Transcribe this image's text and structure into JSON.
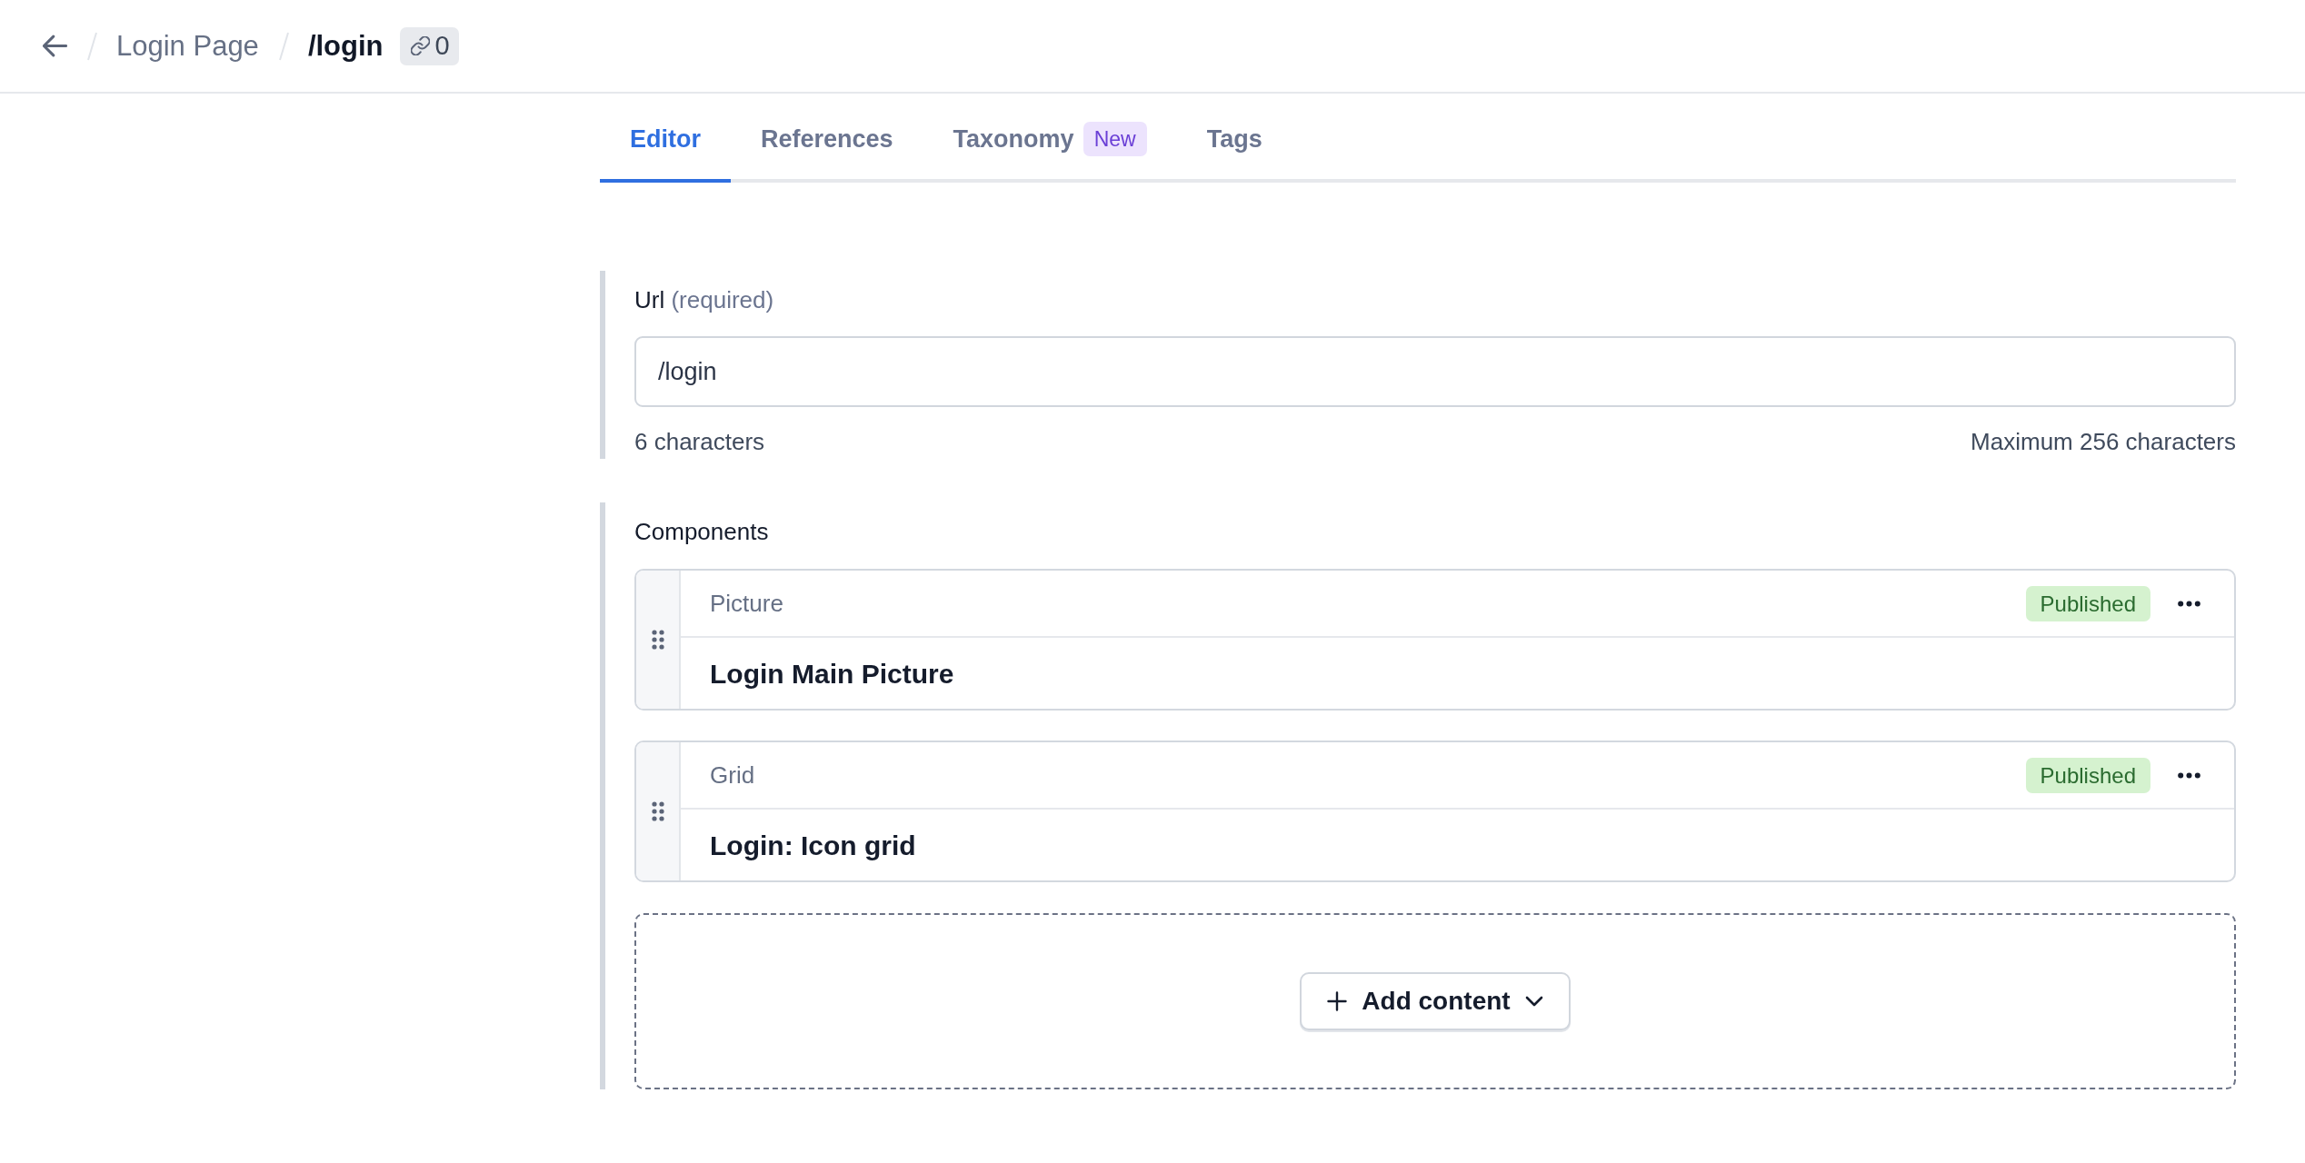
{
  "header": {
    "breadcrumbs": [
      {
        "label": "Login Page",
        "current": false
      },
      {
        "label": "/login",
        "current": true
      }
    ],
    "link_count": "0"
  },
  "tabs": [
    {
      "label": "Editor",
      "selected": true
    },
    {
      "label": "References",
      "selected": false
    },
    {
      "label": "Taxonomy",
      "selected": false,
      "badge": "New"
    },
    {
      "label": "Tags",
      "selected": false
    }
  ],
  "url_field": {
    "label": "Url",
    "hint": "(required)",
    "value": "/login",
    "character_count": "6 characters",
    "limit": "Maximum 256 characters"
  },
  "components": {
    "label": "Components",
    "items": [
      {
        "type": "Picture",
        "status": "Published",
        "title": "Login Main Picture"
      },
      {
        "type": "Grid",
        "status": "Published",
        "title": "Login: Icon grid"
      }
    ],
    "add_button": "Add content"
  }
}
